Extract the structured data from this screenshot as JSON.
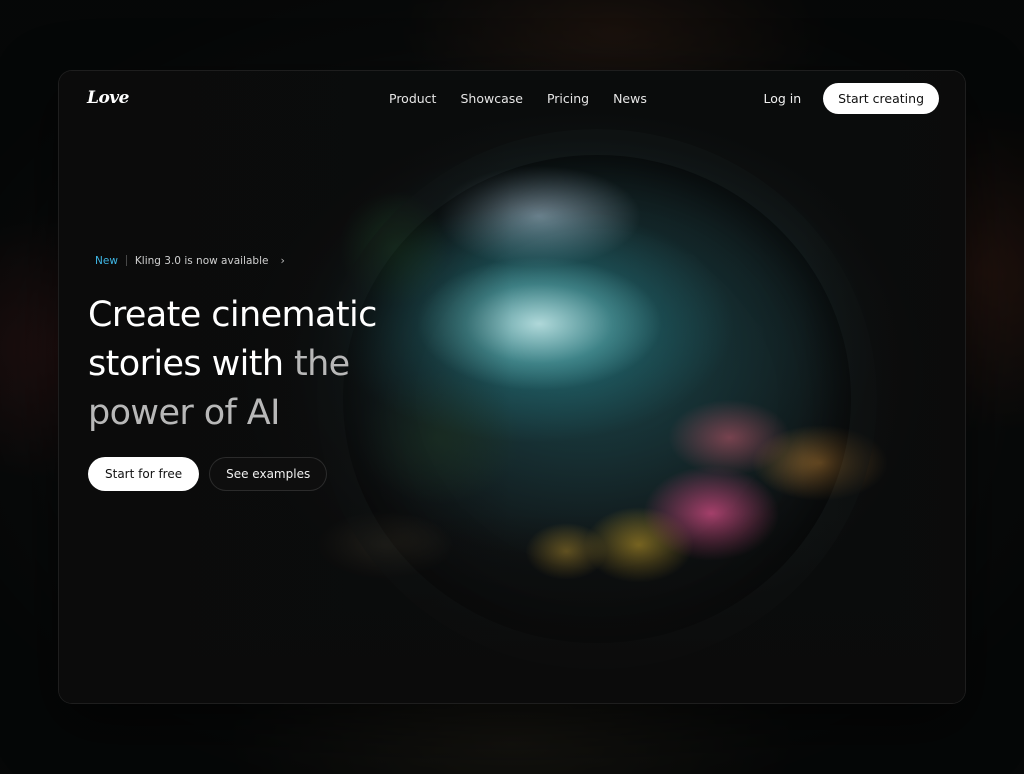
{
  "brand": {
    "logo_text": "Love"
  },
  "nav": {
    "links": [
      "Product",
      "Showcase",
      "Pricing",
      "News"
    ],
    "login_label": "Log in",
    "cta_label": "Start creating"
  },
  "hero": {
    "badge": {
      "tag": "New",
      "text": "Kling 3.0 is now available",
      "chevron": "›"
    },
    "headline": {
      "line1": "Create cinematic",
      "line2_bright": "stories with ",
      "line2_dim": "the",
      "line3_dim": "power of AI"
    },
    "primary_cta": "Start for free",
    "secondary_cta": "See examples"
  },
  "colors": {
    "accent_tag": "#3fb6e4",
    "card_bg": "#0b0b0b",
    "button_bg": "#ffffff"
  },
  "imagery": {
    "hero_scene": "underwater coral reef seen through a circular tunnel"
  }
}
